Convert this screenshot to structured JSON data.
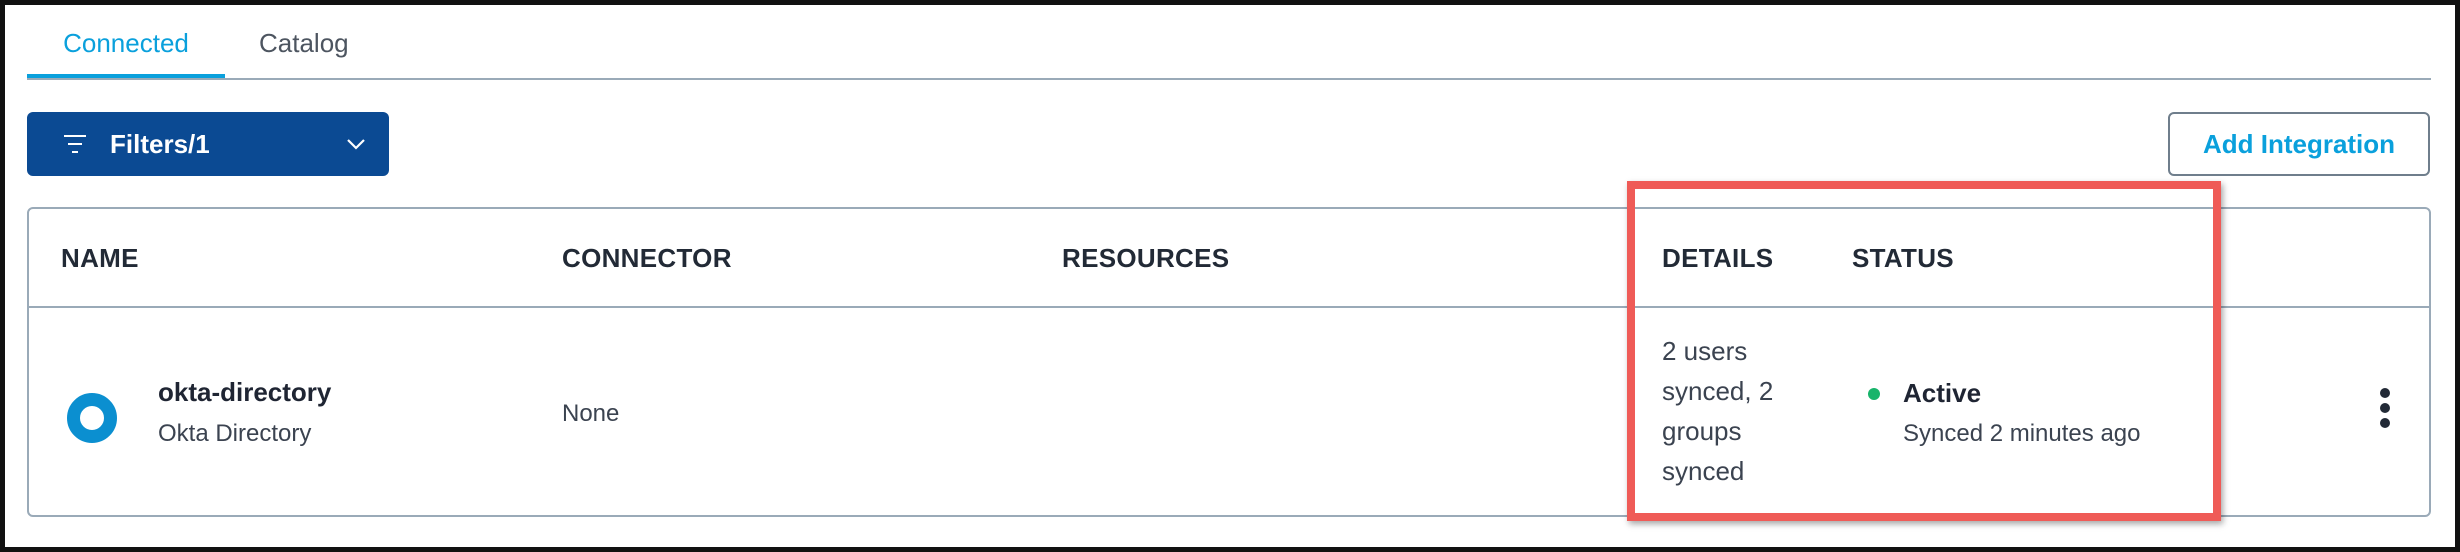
{
  "tabs": [
    {
      "label": "Connected",
      "active": true
    },
    {
      "label": "Catalog",
      "active": false
    }
  ],
  "toolbar": {
    "filters_label": "Filters/1",
    "add_label": "Add Integration"
  },
  "table": {
    "headers": {
      "name": "NAME",
      "connector": "CONNECTOR",
      "resources": "RESOURCES",
      "details": "DETAILS",
      "status": "STATUS"
    },
    "rows": [
      {
        "name": "okta-directory",
        "type": "Okta Directory",
        "connector": "None",
        "resources": "",
        "details": "2 users synced, 2 groups synced",
        "status": "Active",
        "status_sub": "Synced 2 minutes ago"
      }
    ]
  },
  "colors": {
    "accent": "#0aa0dc",
    "primary_button": "#0b4a93",
    "status_active": "#18b46b",
    "highlight": "#ef5b57"
  },
  "icons": {
    "filter": "filter-lines-icon",
    "dropdown": "chevron-down-icon",
    "row_icon": "okta-logo-icon",
    "status": "status-dot-icon",
    "more": "kebab-menu-icon"
  }
}
